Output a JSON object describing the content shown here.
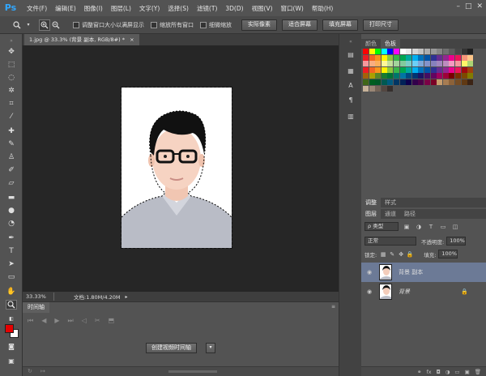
{
  "menubar": {
    "logo": "Ps",
    "items": [
      "文件(F)",
      "编辑(E)",
      "图像(I)",
      "图层(L)",
      "文字(Y)",
      "选择(S)",
      "滤镜(T)",
      "3D(D)",
      "视图(V)",
      "窗口(W)",
      "帮助(H)"
    ],
    "window_controls": [
      "–",
      "□",
      "✕"
    ]
  },
  "options_bar": {
    "zoom_tool_icon": "zoom-icon",
    "checkboxes": [
      "调整窗口大小以满屏显示",
      "缩放所有窗口",
      "细微缩放"
    ],
    "buttons": [
      "实际像素",
      "适合屏幕",
      "填充屏幕",
      "打印尺寸"
    ]
  },
  "document": {
    "tab_title": "1.jpg @ 33.3% (背景 副本, RGB/8#) *",
    "close_glyph": "×"
  },
  "status": {
    "zoom": "33.33%",
    "doc_info": "文档:1.80M/4.20M"
  },
  "timeline": {
    "tab_label": "时间轴",
    "create_button": "创建视频时间轴",
    "dropdown_glyph": "▾"
  },
  "swatches_panel": {
    "tabs": [
      "颜色",
      "色板"
    ],
    "active_tab": 1,
    "colors": [
      "#ff0000",
      "#ffff00",
      "#00ff00",
      "#00ffff",
      "#0000ff",
      "#ff00ff",
      "#ffffff",
      "#ebebeb",
      "#d6d6d6",
      "#c2c2c2",
      "#adadad",
      "#999999",
      "#858585",
      "#707070",
      "#5c5c5c",
      "#474747",
      "#333333",
      "#1f1f1f",
      "#ed1c24",
      "#f26522",
      "#f7941d",
      "#fff200",
      "#8dc63f",
      "#39b54a",
      "#00a651",
      "#00a99d",
      "#00aeef",
      "#0072bc",
      "#0054a6",
      "#2e3192",
      "#662d91",
      "#92278f",
      "#ec008c",
      "#ed145b",
      "#f69679",
      "#fdc689",
      "#f5989d",
      "#f9ad81",
      "#fbaf5d",
      "#fff799",
      "#c4df9b",
      "#a3d39c",
      "#82ca9c",
      "#7accc8",
      "#6dcff6",
      "#7da7d9",
      "#8393ca",
      "#8781bd",
      "#a186be",
      "#bd8cbf",
      "#f49ac1",
      "#f6989d",
      "#fff568",
      "#acd373",
      "#ed1c24",
      "#f26522",
      "#f7941d",
      "#fff200",
      "#8dc63f",
      "#39b54a",
      "#00a651",
      "#00a99d",
      "#00aeef",
      "#0072bc",
      "#0054a6",
      "#2e3192",
      "#662d91",
      "#92278f",
      "#ec008c",
      "#ed145b",
      "#9e0b0f",
      "#a0410d",
      "#a3620a",
      "#aba000",
      "#598527",
      "#197b30",
      "#007236",
      "#00746b",
      "#0076a3",
      "#004a80",
      "#003471",
      "#1b1464",
      "#440e62",
      "#630460",
      "#9e005d",
      "#9e0039",
      "#790000",
      "#7b2e00",
      "#7d4900",
      "#827b00",
      "#406618",
      "#005e20",
      "#005826",
      "#005952",
      "#005b7f",
      "#003663",
      "#002157",
      "#0d004c",
      "#32004b",
      "#4b0049",
      "#7b0046",
      "#7a0026",
      "#c69c6d",
      "#a67c52",
      "#8c6239",
      "#754c24",
      "#603913",
      "#3c2415",
      "#c7b299",
      "#998675",
      "#736357",
      "#534741",
      "#362f2d"
    ]
  },
  "adjust_panel": {
    "tabs": [
      "调整",
      "样式"
    ]
  },
  "layers_panel": {
    "tabs": [
      "图层",
      "通道",
      "路径"
    ],
    "filter_select": "ρ 类型",
    "blend_mode": "正常",
    "opacity_label": "不透明度:",
    "opacity_value": "100%",
    "lock_label": "锁定:",
    "fill_label": "填充:",
    "fill_value": "100%",
    "layers": [
      {
        "name": "背景 副本",
        "selected": true,
        "locked": false
      },
      {
        "name": "背景",
        "selected": false,
        "locked": true
      }
    ],
    "footer_icons": [
      "fx",
      "◘",
      "◑",
      "▭",
      "▣",
      "🗑"
    ]
  }
}
